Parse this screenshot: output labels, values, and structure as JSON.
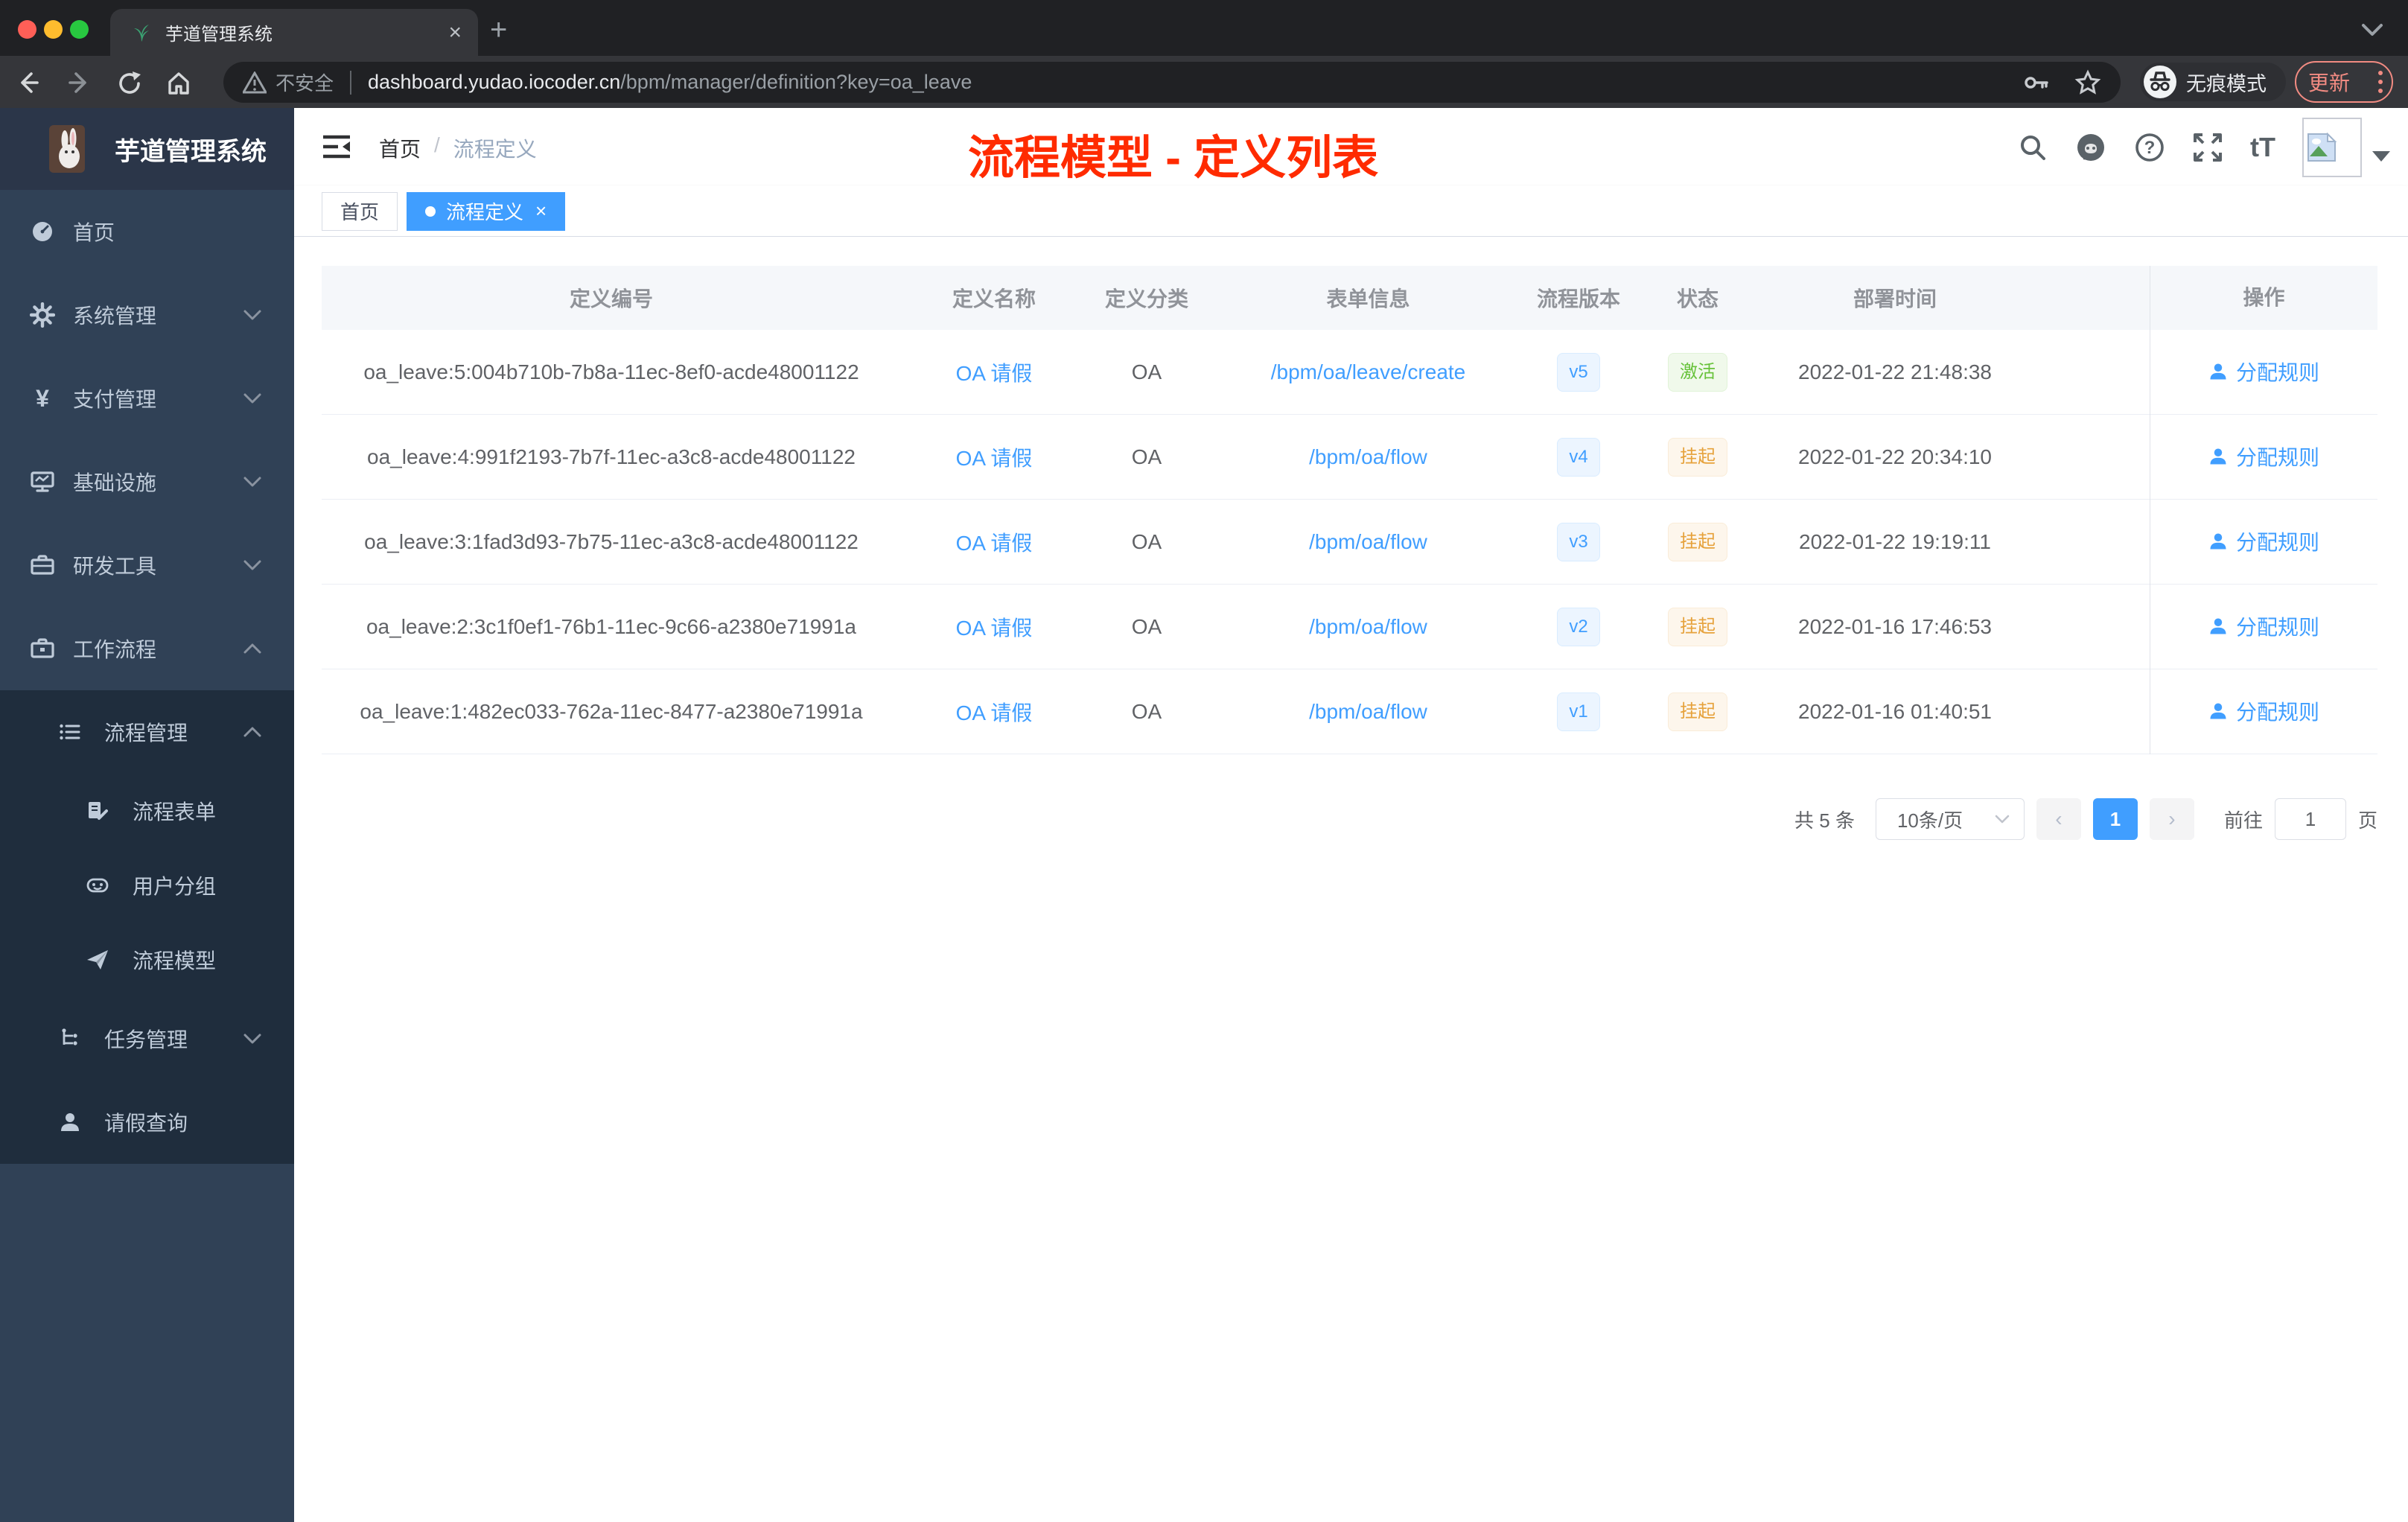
{
  "browser": {
    "tab_title": "芋道管理系统",
    "new_tab": "+",
    "close_tab": "×",
    "security_label": "不安全",
    "url_domain": "dashboard.yudao.iocoder.cn",
    "url_path": "/bpm/manager/definition?key=oa_leave",
    "incognito_label": "无痕模式",
    "update_label": "更新"
  },
  "sidebar": {
    "app_title": "芋道管理系统",
    "items": [
      {
        "label": "首页"
      },
      {
        "label": "系统管理"
      },
      {
        "label": "支付管理"
      },
      {
        "label": "基础设施"
      },
      {
        "label": "研发工具"
      },
      {
        "label": "工作流程"
      }
    ],
    "workflow": {
      "process_management": {
        "label": "流程管理"
      },
      "process_children": [
        {
          "label": "流程表单"
        },
        {
          "label": "用户分组"
        },
        {
          "label": "流程模型"
        }
      ],
      "task_management": {
        "label": "任务管理"
      },
      "leave_query": {
        "label": "请假查询"
      }
    }
  },
  "header": {
    "breadcrumb_home": "首页",
    "breadcrumb_sep": "/",
    "breadcrumb_current": "流程定义",
    "annotation": "流程模型 - 定义列表",
    "font_icon_label": "tT"
  },
  "tabs": [
    {
      "label": "首页"
    },
    {
      "label": "流程定义",
      "close": "×"
    }
  ],
  "table": {
    "columns": [
      "定义编号",
      "定义名称",
      "定义分类",
      "表单信息",
      "流程版本",
      "状态",
      "部署时间",
      "操作"
    ],
    "rows": [
      {
        "id": "oa_leave:5:004b710b-7b8a-11ec-8ef0-acde48001122",
        "name": "OA 请假",
        "category": "OA",
        "form": "/bpm/oa/leave/create",
        "version": "v5",
        "status": "激活",
        "time": "2022-01-22 21:48:38",
        "action": "分配规则"
      },
      {
        "id": "oa_leave:4:991f2193-7b7f-11ec-a3c8-acde48001122",
        "name": "OA 请假",
        "category": "OA",
        "form": "/bpm/oa/flow",
        "version": "v4",
        "status": "挂起",
        "time": "2022-01-22 20:34:10",
        "action": "分配规则"
      },
      {
        "id": "oa_leave:3:1fad3d93-7b75-11ec-a3c8-acde48001122",
        "name": "OA 请假",
        "category": "OA",
        "form": "/bpm/oa/flow",
        "version": "v3",
        "status": "挂起",
        "time": "2022-01-22 19:19:11",
        "action": "分配规则"
      },
      {
        "id": "oa_leave:2:3c1f0ef1-76b1-11ec-9c66-a2380e71991a",
        "name": "OA 请假",
        "category": "OA",
        "form": "/bpm/oa/flow",
        "version": "v2",
        "status": "挂起",
        "time": "2022-01-16 17:46:53",
        "action": "分配规则"
      },
      {
        "id": "oa_leave:1:482ec033-762a-11ec-8477-a2380e71991a",
        "name": "OA 请假",
        "category": "OA",
        "form": "/bpm/oa/flow",
        "version": "v1",
        "status": "挂起",
        "time": "2022-01-16 01:40:51",
        "action": "分配规则"
      }
    ]
  },
  "pagination": {
    "total": "共 5 条",
    "page_size": "10条/页",
    "prev": "‹",
    "current": "1",
    "next": "›",
    "goto_label": "前往",
    "goto_value": "1",
    "page_unit": "页"
  },
  "colors": {
    "accent": "#409eff",
    "sidebar_bg": "#304156",
    "submenu_bg": "#1f2d3d",
    "annotation_red": "#ff2b00",
    "tag_info": "#409eff",
    "tag_success": "#67c23a",
    "tag_warning": "#e6a23c"
  }
}
